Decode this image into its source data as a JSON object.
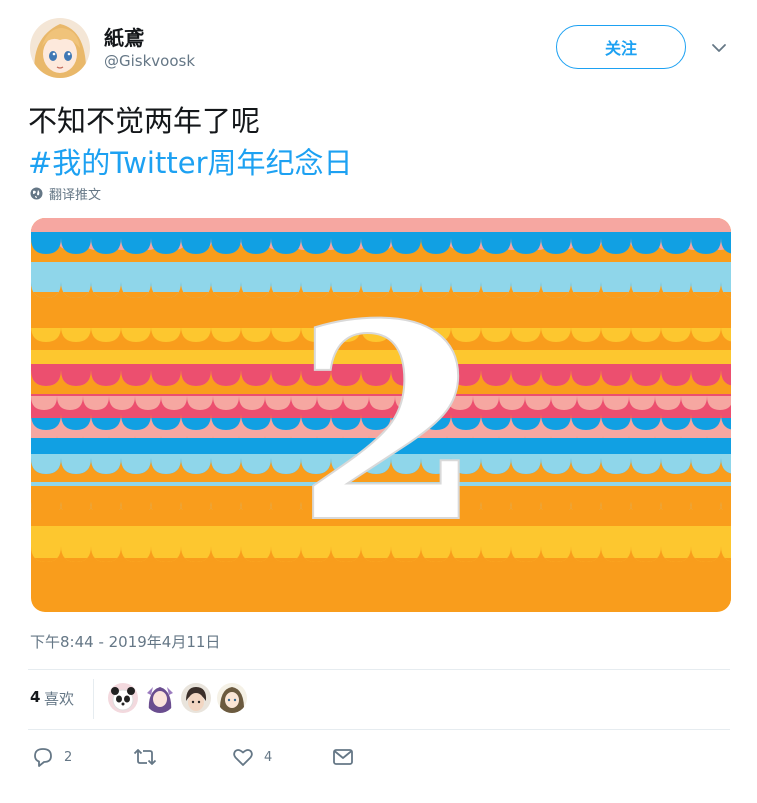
{
  "user": {
    "display_name": "紙鳶",
    "handle": "@Giskvoosk",
    "avatar_icon": "anime-girl-avatar"
  },
  "header": {
    "follow_label": "关注",
    "menu_icon": "chevron-down-icon"
  },
  "tweet": {
    "text_line": "不知不觉两年了呢",
    "hashtag": "#我的Twitter周年纪念日",
    "translate_label": "翻译推文",
    "media_label": "2"
  },
  "meta": {
    "timestamp": "下午8:44 - 2019年4月11日",
    "likes_count": "4",
    "likes_label": "喜欢"
  },
  "likers": [
    "panda-avatar",
    "anime-purple-avatar",
    "boy-avatar",
    "girl-avatar"
  ],
  "actions": {
    "reply_count": "2",
    "retweet_count": "",
    "like_count": "4"
  },
  "colors": {
    "accent": "#1da1f2",
    "text": "#14171a",
    "secondary": "#657786",
    "divider": "#e6ecf0"
  }
}
